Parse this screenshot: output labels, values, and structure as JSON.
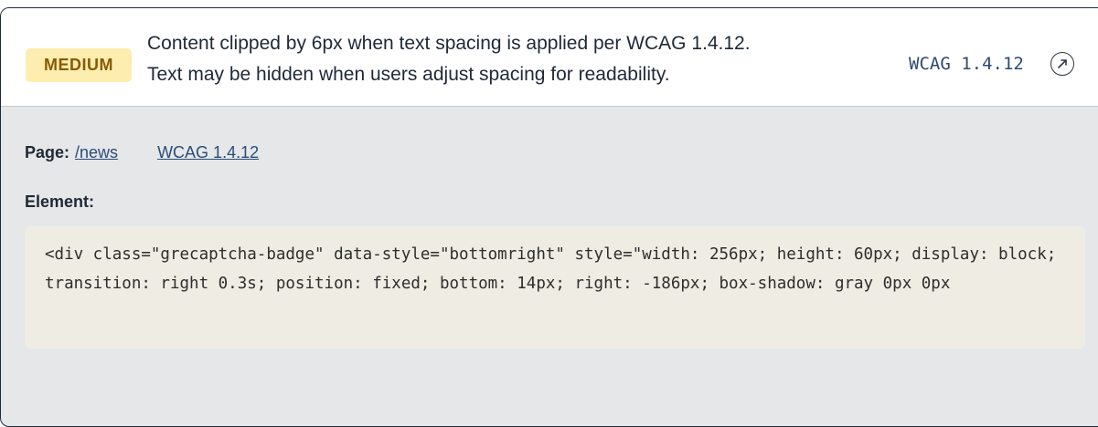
{
  "issue": {
    "severity": "MEDIUM",
    "message_line1": "Content clipped by 6px when text spacing is applied per WCAG 1.4.12.",
    "message_line2": "Text may be hidden when users adjust spacing for readability.",
    "wcag_code": "WCAG 1.4.12",
    "expand_icon": "link-arrow-icon"
  },
  "details": {
    "page_label": "Page:",
    "page_link": "/news",
    "wcag_link": "WCAG 1.4.12",
    "element_label": "Element:",
    "element_code": "<div class=\"grecaptcha-badge\" data-style=\"bottomright\" style=\"width: 256px; height: 60px; display: block; transition: right 0.3s; position: fixed; bottom: 14px; right: -186px; box-shadow: gray 0px 0px"
  },
  "colors": {
    "badge_bg": "#fdeeb0",
    "badge_text": "#8a5a00",
    "link": "#2a4d7a",
    "panel_bg": "#e6e7e8",
    "code_bg": "#efece4"
  }
}
